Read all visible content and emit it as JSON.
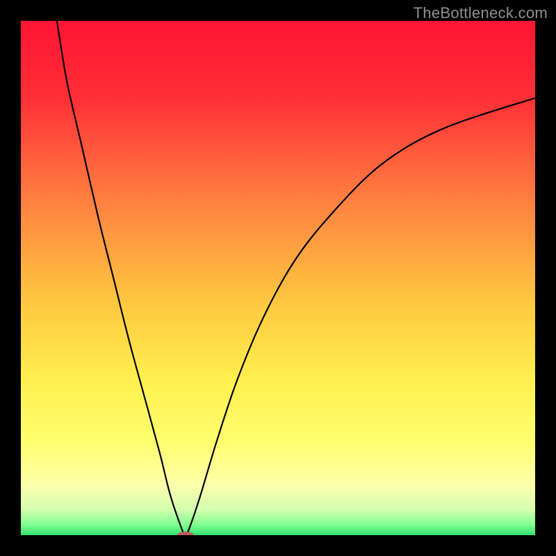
{
  "watermark": "TheBottleneck.com",
  "chart_data": {
    "type": "line",
    "title": "",
    "xlabel": "",
    "ylabel": "",
    "xlim": [
      0,
      100
    ],
    "ylim": [
      0,
      100
    ],
    "background_gradient_stops": [
      {
        "offset": 0.0,
        "color": "#ff1534"
      },
      {
        "offset": 0.15,
        "color": "#ff2f36"
      },
      {
        "offset": 0.35,
        "color": "#ff8040"
      },
      {
        "offset": 0.55,
        "color": "#ffc840"
      },
      {
        "offset": 0.7,
        "color": "#fff050"
      },
      {
        "offset": 0.82,
        "color": "#ffff70"
      },
      {
        "offset": 0.9,
        "color": "#ffffaa"
      },
      {
        "offset": 0.95,
        "color": "#d4ffb0"
      },
      {
        "offset": 0.98,
        "color": "#80ff90"
      },
      {
        "offset": 1.0,
        "color": "#30e070"
      }
    ],
    "series": [
      {
        "name": "bottleneck-curve",
        "color": "#000000",
        "x": [
          7,
          9,
          12,
          15,
          18,
          21,
          24,
          27,
          29,
          31,
          32,
          33,
          35,
          38,
          42,
          47,
          53,
          60,
          70,
          82,
          100
        ],
        "y": [
          100,
          88,
          75,
          62,
          50,
          38,
          27,
          16,
          8,
          2,
          0,
          2,
          8,
          18,
          30,
          42,
          53,
          62,
          72,
          79,
          85
        ]
      }
    ],
    "marker": {
      "name": "min-marker",
      "x": 32,
      "y": 0,
      "color": "#c15a5a",
      "rx": 12,
      "ry": 5
    }
  }
}
